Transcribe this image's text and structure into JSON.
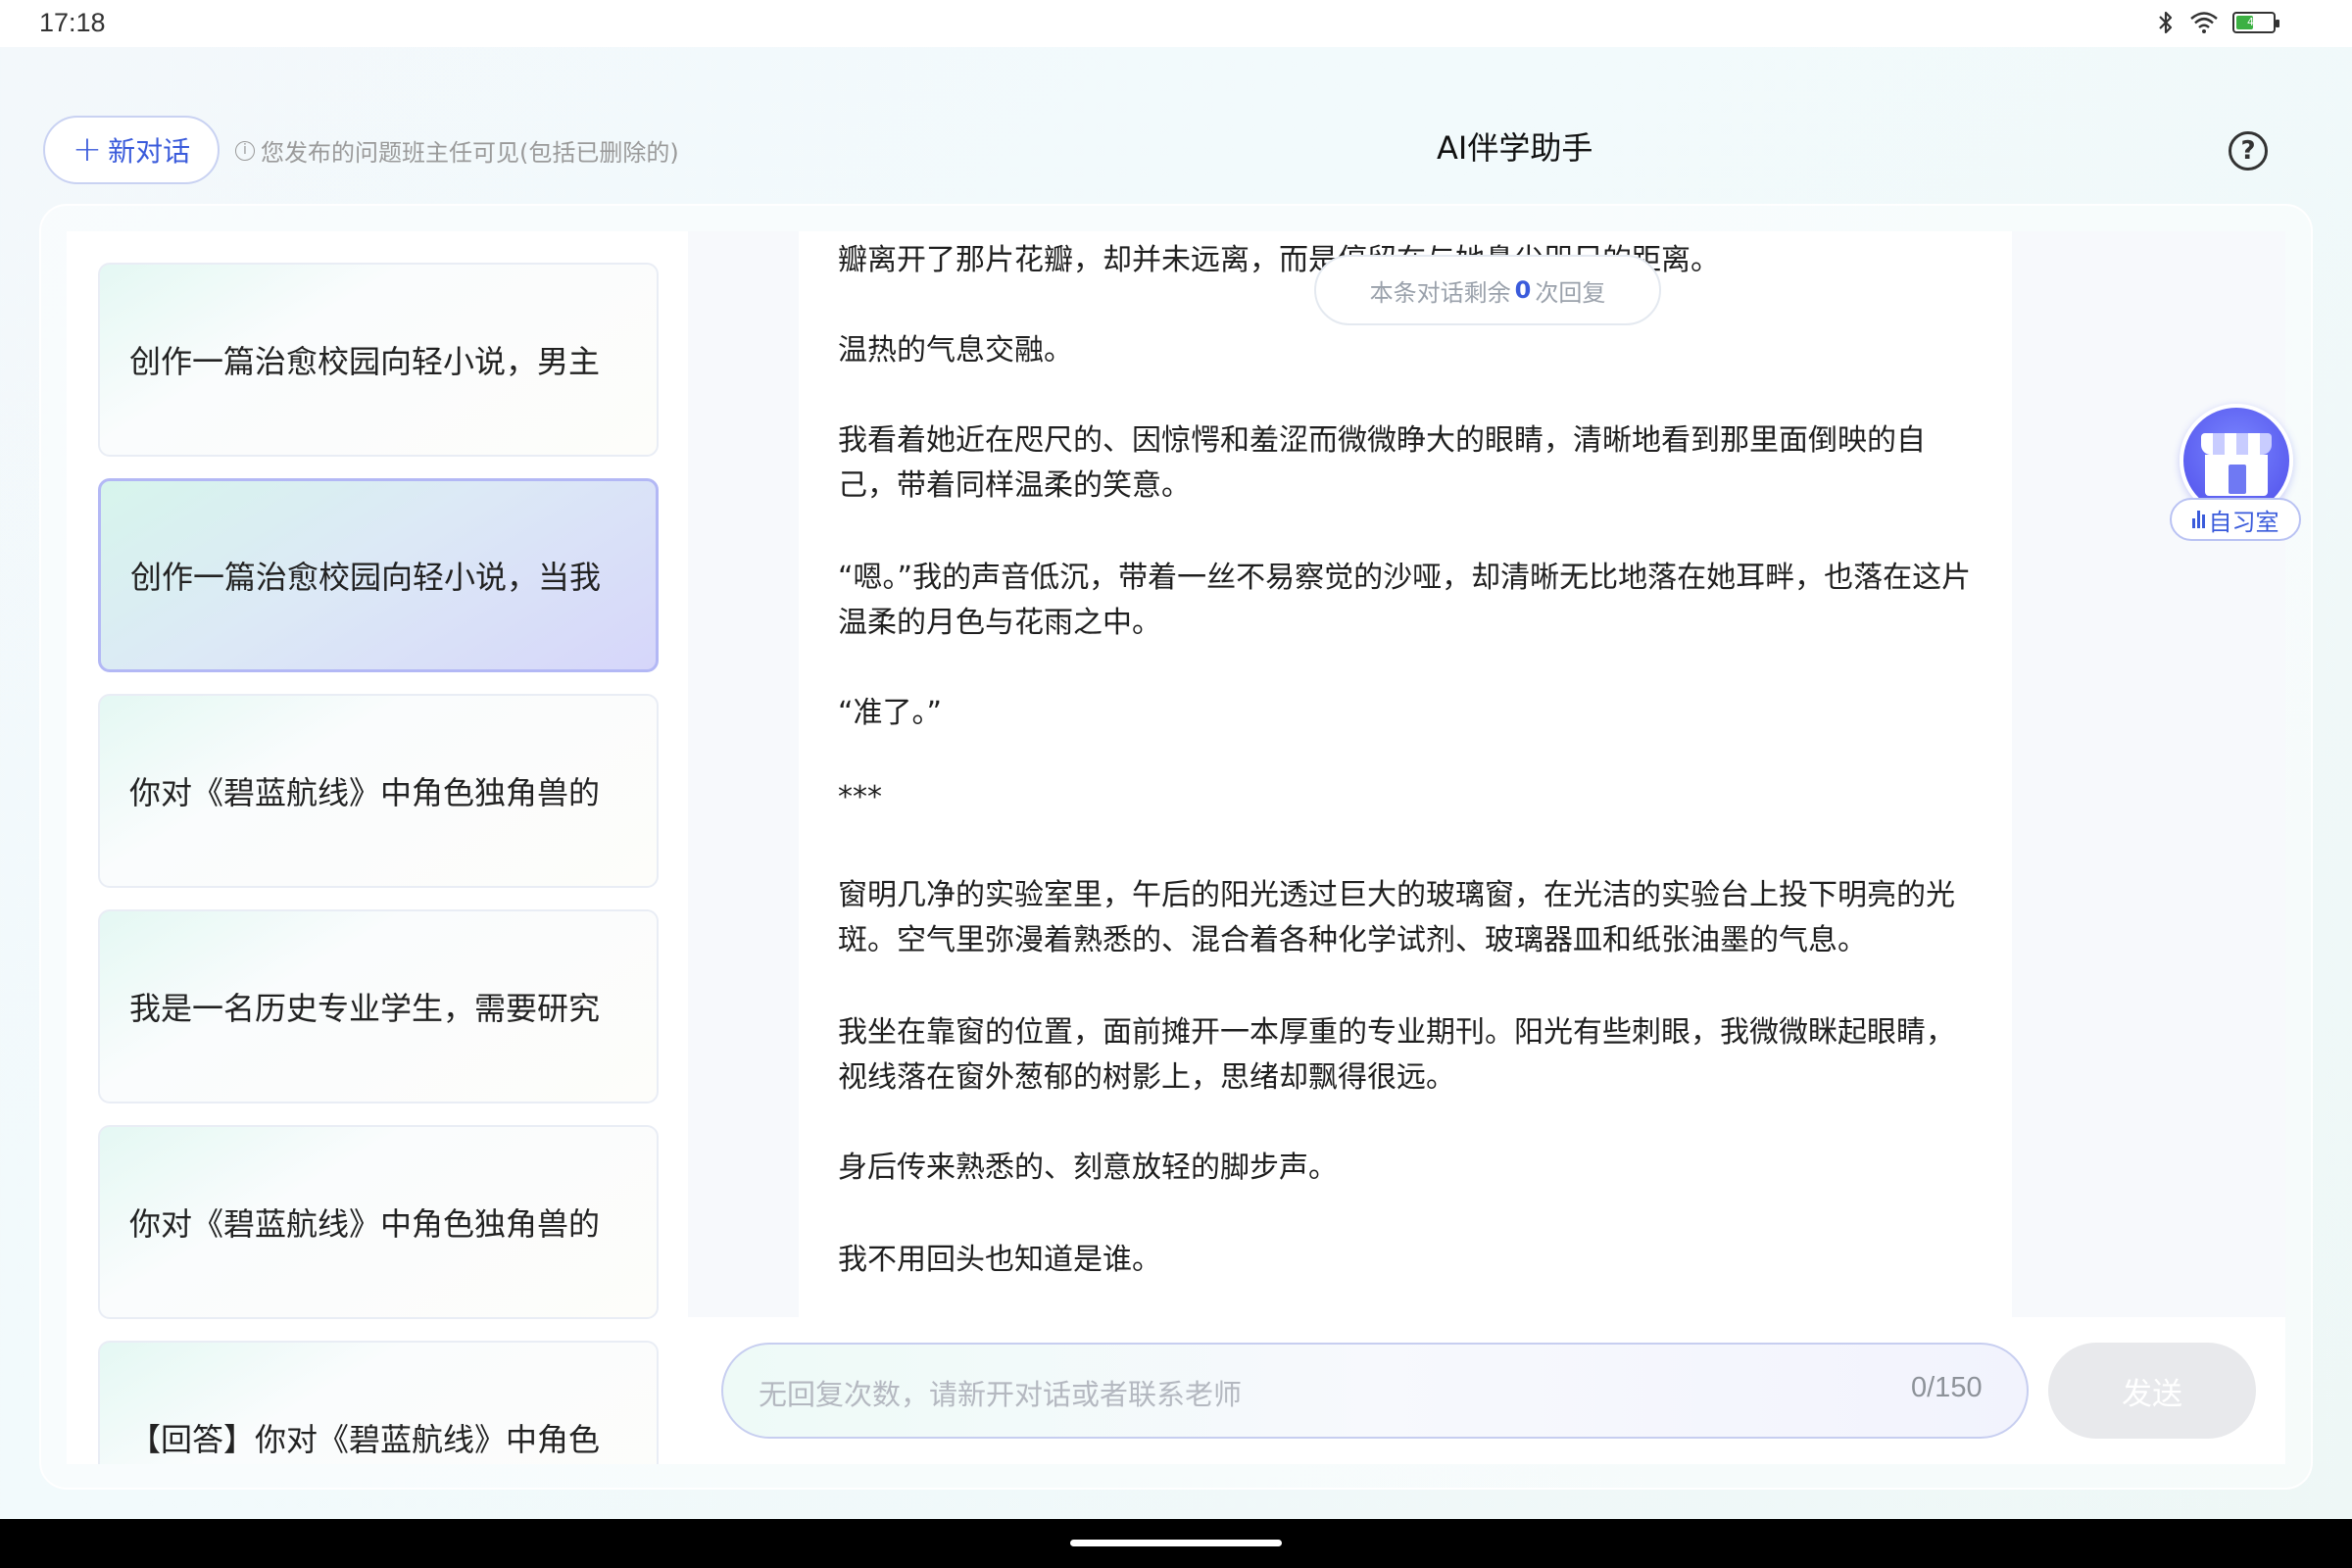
{
  "status_bar": {
    "time": "17:18",
    "battery_level": "46",
    "icons": [
      "bluetooth-icon",
      "wifi-icon",
      "battery-icon"
    ]
  },
  "header": {
    "new_chat_label": "新对话",
    "notice": "您发布的问题班主任可见(包括已删除的)",
    "title": "AI伴学助手",
    "help_symbol": "?"
  },
  "sidebar": {
    "items": [
      {
        "label": "创作一篇治愈校园向轻小说，男主",
        "active": false
      },
      {
        "label": "创作一篇治愈校园向轻小说，当我",
        "active": true
      },
      {
        "label": "你对《碧蓝航线》中角色独角兽的",
        "active": false
      },
      {
        "label": "我是一名历史专业学生，需要研究",
        "active": false
      },
      {
        "label": "你对《碧蓝航线》中角色独角兽的",
        "active": false
      },
      {
        "label": "【回答】你对《碧蓝航线》中角色",
        "active": false
      }
    ]
  },
  "chat": {
    "remaining": {
      "prefix": "本条对话剩余",
      "count": "0",
      "suffix": "次回复"
    },
    "lines": [
      "瓣离开了那片花瓣，却并未远离，而是停留在与她鼻尖咫尺的距离。",
      "温热的气息交融。",
      "我看着她近在咫尺的、因惊愕和羞涩而微微睁大的眼睛，清晰地看到那里面倒映的自",
      "己，带着同样温柔的笑意。",
      "“嗯。”我的声音低沉，带着一丝不易察觉的沙哑，却清晰无比地落在她耳畔，也落在这片",
      "温柔的月色与花雨之中。",
      "“准了。”",
      "***",
      "窗明几净的实验室里，午后的阳光透过巨大的玻璃窗，在光洁的实验台上投下明亮的光",
      "斑。空气里弥漫着熟悉的、混合着各种化学试剂、玻璃器皿和纸张油墨的气息。",
      "我坐在靠窗的位置，面前摊开一本厚重的专业期刊。阳光有些刺眼，我微微眯起眼睛，",
      "视线落在窗外葱郁的树影上，思绪却飘得很远。",
      "身后传来熟悉的、刻意放轻的脚步声。",
      "我不用回头也知道是谁。"
    ]
  },
  "input": {
    "placeholder": "无回复次数，请新开对话或者联系老师",
    "char_count": "0/150",
    "send_label": "发送"
  },
  "study_room": {
    "label": "自习室"
  },
  "colors": {
    "accent": "#3a5bdb",
    "active_item_border": "#b3b8f5",
    "disabled_button": "#e8e9ec"
  }
}
